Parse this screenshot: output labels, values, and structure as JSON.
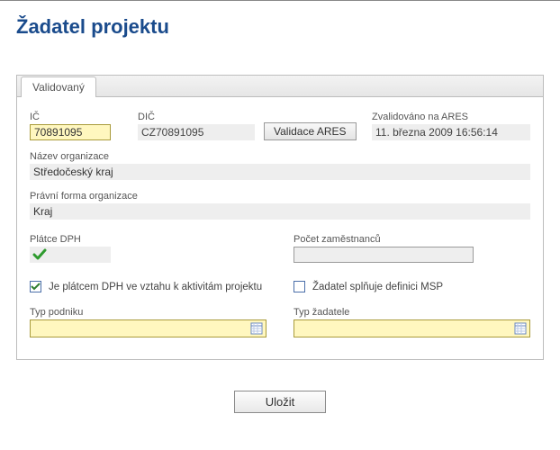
{
  "title": "Žadatel projektu",
  "tab": {
    "label": "Validovaný"
  },
  "fields": {
    "ic": {
      "label": "IČ",
      "value": "70891095"
    },
    "dic": {
      "label": "DIČ",
      "value": "CZ70891095"
    },
    "validace_btn": "Validace ARES",
    "ares": {
      "label": "Zvalidováno na ARES",
      "value": "11. března 2009 16:56:14"
    },
    "nazev_org": {
      "label": "Název organizace",
      "value": "Středočeský kraj"
    },
    "pravni_forma": {
      "label": "Právní forma organizace",
      "value": "Kraj"
    },
    "platce_dph": {
      "label": "Plátce DPH",
      "checked": true
    },
    "pocet_zam": {
      "label": "Počet zaměstnanců",
      "value": ""
    },
    "cb_dph": {
      "label": "Je plátcem DPH ve vztahu k aktivitám projektu",
      "checked": true
    },
    "cb_msp": {
      "label": "Žadatel splňuje definici MSP",
      "checked": false
    },
    "typ_podniku": {
      "label": "Typ podniku",
      "value": ""
    },
    "typ_zadatele": {
      "label": "Typ žadatele",
      "value": ""
    }
  },
  "buttons": {
    "save": "Uložit"
  }
}
